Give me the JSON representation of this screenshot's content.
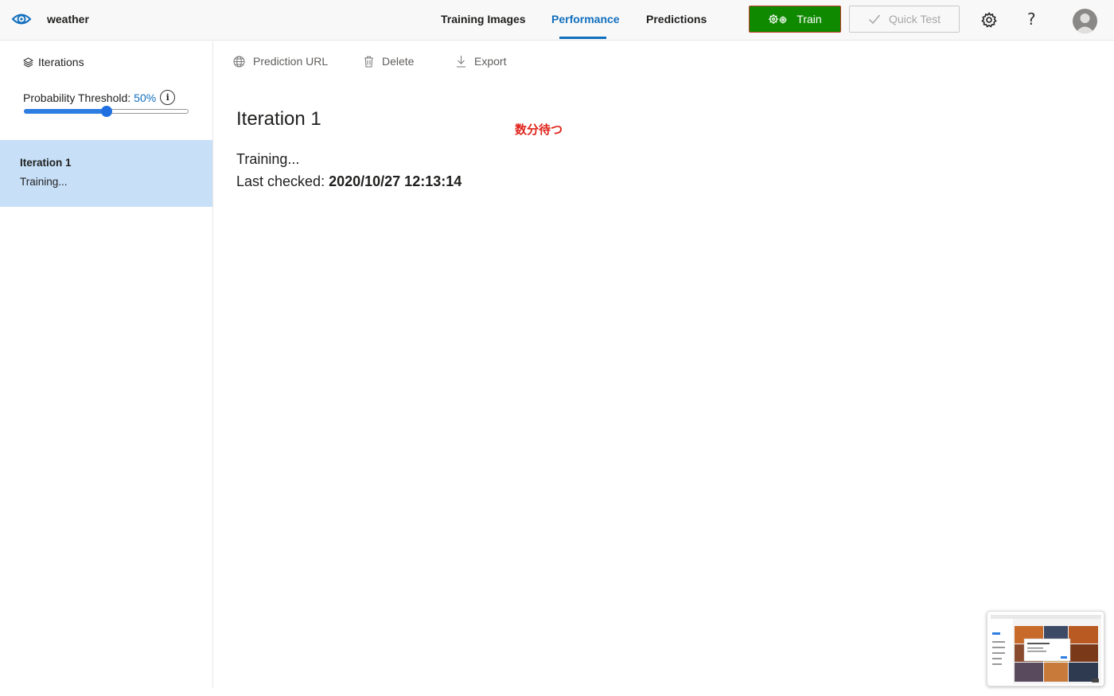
{
  "header": {
    "project_name": "weather",
    "tabs": [
      {
        "label": "Training Images",
        "active": false
      },
      {
        "label": "Performance",
        "active": true
      },
      {
        "label": "Predictions",
        "active": false
      }
    ],
    "train_label": "Train",
    "quick_test_label": "Quick Test",
    "help_label": "?",
    "icons": [
      "eye-logo-icon",
      "gears-icon",
      "checkmark-icon",
      "settings-icon",
      "help-icon",
      "avatar"
    ]
  },
  "sidebar": {
    "iterations_label": "Iterations",
    "threshold_label": "Probability Threshold:",
    "threshold_value": "50%",
    "threshold_fraction": 0.5,
    "info_label": "i",
    "items": [
      {
        "name": "Iteration 1",
        "status": "Training...",
        "selected": true
      }
    ]
  },
  "toolbar": {
    "prediction_url_label": "Prediction URL",
    "delete_label": "Delete",
    "export_label": "Export"
  },
  "main": {
    "title": "Iteration 1",
    "annotation": "数分待つ",
    "status": "Training...",
    "last_checked_label": "Last checked:",
    "last_checked_value": "2020/10/27 12:13:14"
  },
  "colors": {
    "accent": "#106ebe",
    "train_button": "#0f8a00",
    "selected_item": "#c7e0f8",
    "annotation": "#e0241b"
  }
}
